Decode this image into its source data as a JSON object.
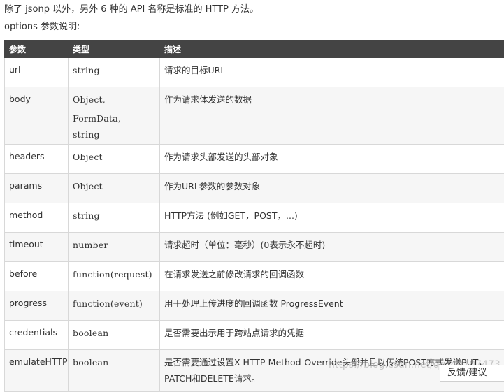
{
  "intro": {
    "line1": "除了 jsonp 以外，另外 6 种的 API 名称是标准的 HTTP 方法。",
    "line2": "options 参数说明:"
  },
  "table": {
    "headers": [
      "参数",
      "类型",
      "描述"
    ],
    "rows": [
      {
        "param": "url",
        "type": [
          "string"
        ],
        "desc": [
          "请求的目标URL"
        ]
      },
      {
        "param": "body",
        "type": [
          "Object, FormData,",
          "string"
        ],
        "desc": [
          "作为请求体发送的数据"
        ]
      },
      {
        "param": "headers",
        "type": [
          "Object"
        ],
        "desc": [
          "作为请求头部发送的头部对象"
        ]
      },
      {
        "param": "params",
        "type": [
          "Object"
        ],
        "desc": [
          "作为URL参数的参数对象"
        ]
      },
      {
        "param": "method",
        "type": [
          "string"
        ],
        "desc": [
          "HTTP方法 (例如GET，POST，...)"
        ]
      },
      {
        "param": "timeout",
        "type": [
          "number"
        ],
        "desc": [
          "请求超时（单位：毫秒）(0表示永不超时)"
        ]
      },
      {
        "param": "before",
        "type": [
          "function(request)"
        ],
        "desc": [
          "在请求发送之前修改请求的回调函数"
        ]
      },
      {
        "param": "progress",
        "type": [
          "function(event)"
        ],
        "desc": [
          "用于处理上传进度的回调函数 ProgressEvent"
        ]
      },
      {
        "param": "credentials",
        "type": [
          "boolean"
        ],
        "desc": [
          "是否需要出示用于跨站点请求的凭据"
        ]
      },
      {
        "param": "emulateHTTP",
        "type": [
          "boolean"
        ],
        "desc": [
          "是否需要通过设置X-HTTP-Method-Override头部并且以传统POST方式发送PUT，",
          "PATCH和DELETE请求。"
        ]
      }
    ]
  },
  "watermark": "https://blog.csdn.net/qq_40107473",
  "feedback_label": "反馈/建议"
}
